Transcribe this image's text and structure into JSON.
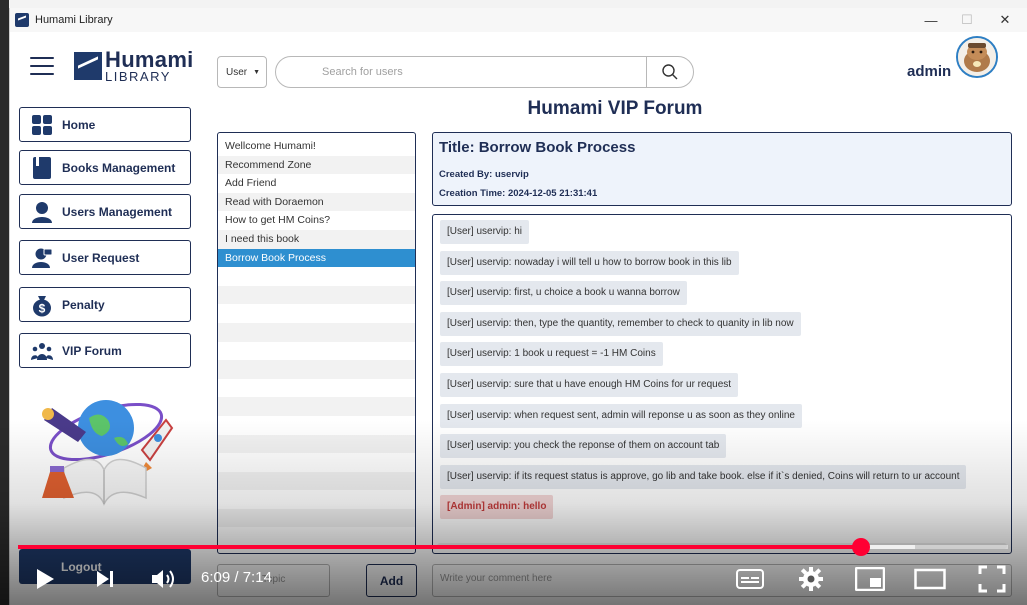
{
  "window": {
    "title": "Humami Library",
    "minimize": "—",
    "maximize": "☐",
    "close": "✕"
  },
  "logo": {
    "line1": "Humami",
    "line2": "LIBRARY"
  },
  "search": {
    "type_label": "User",
    "placeholder": "Search for users"
  },
  "user": {
    "name": "admin"
  },
  "page_title": "Humami VIP Forum",
  "nav": [
    {
      "label": "Home",
      "icon": "grid-icon"
    },
    {
      "label": "Books Management",
      "icon": "book-icon"
    },
    {
      "label": "Users Management",
      "icon": "user-icon"
    },
    {
      "label": "User Request",
      "icon": "user-request-icon"
    },
    {
      "label": "Penalty",
      "icon": "money-bag-icon"
    },
    {
      "label": "VIP Forum",
      "icon": "people-icon"
    }
  ],
  "logout_label": "Logout",
  "topics": [
    "Wellcome Humami!",
    "Recommend Zone",
    "Add Friend",
    "Read with Doraemon",
    "How to get HM Coins?",
    "I need this book",
    "Borrow Book Process"
  ],
  "selected_topic_index": 6,
  "post": {
    "title": "Title: Borrow Book Process",
    "created_by": "Created By: uservip",
    "created_time": "Creation Time: 2024-12-05 21:31:41"
  },
  "comments": [
    {
      "text": "[User] uservip: hi",
      "role": "user"
    },
    {
      "text": "[User] uservip: nowaday i will tell u how to borrow book in this lib",
      "role": "user"
    },
    {
      "text": "[User] uservip: first, u choice a book u wanna borrow",
      "role": "user"
    },
    {
      "text": "[User] uservip: then, type the quantity, remember to check to quanity in lib now",
      "role": "user"
    },
    {
      "text": "[User] uservip: 1 book u request = -1 HM Coins",
      "role": "user"
    },
    {
      "text": "[User] uservip: sure that u have enough HM Coins for ur request",
      "role": "user"
    },
    {
      "text": "[User] uservip: when request sent, admin will reponse u as soon as they online",
      "role": "user"
    },
    {
      "text": "[User] uservip: you check the reponse of them on account tab",
      "role": "user"
    },
    {
      "text": "[User] uservip: if its request status is approve, go lib and take book. else if it`s denied, Coins will return to ur account",
      "role": "user"
    },
    {
      "text": "[Admin] admin: hello",
      "role": "admin"
    }
  ],
  "inputs": {
    "topic_placeholder": "Topic",
    "add_label": "Add",
    "comment_placeholder": "Write your comment here"
  },
  "player": {
    "current_time": "6:09",
    "separator": " / ",
    "duration": "7:14",
    "played_fraction": 0.8512,
    "buffered_fraction": 0.906,
    "accent_color": "#ff0033"
  },
  "colors": {
    "navy": "#1f2e55",
    "selected_row": "#2e8fd0",
    "admin_comment": "#c23b3b"
  }
}
